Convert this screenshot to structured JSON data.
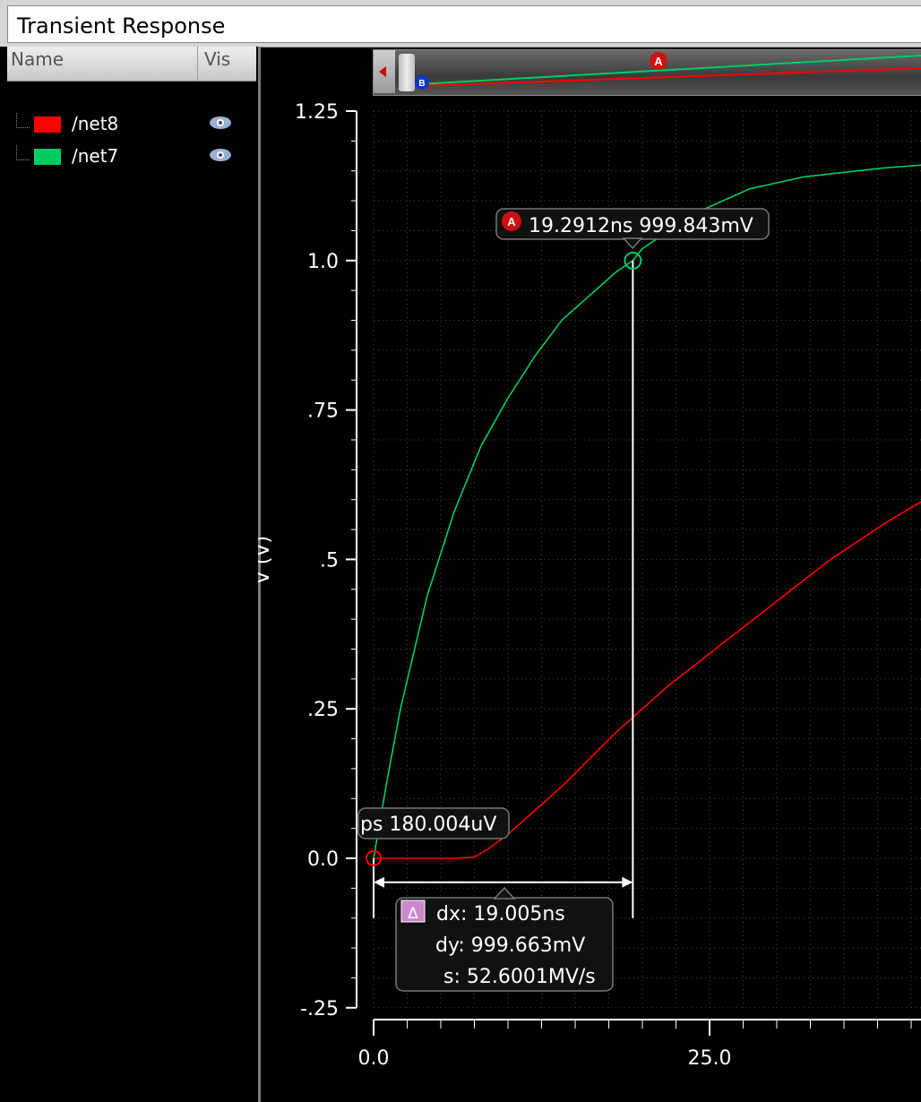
{
  "window": {
    "title": "Transient Response"
  },
  "signal_browser": {
    "col_name": "Name",
    "col_vis": "Vis",
    "signals": [
      {
        "name": "/net8",
        "color": "#ff0000"
      },
      {
        "name": "/net7",
        "color": "#00cc66"
      }
    ]
  },
  "minimap": {
    "marker_a": "A",
    "marker_b": "B"
  },
  "plot": {
    "ylabel": "V (V)",
    "yticks": [
      "1.25",
      "1.0",
      ".75",
      ".5",
      ".25",
      "0.0",
      "-.25"
    ],
    "xticks": [
      "0.0",
      "25.0"
    ],
    "grid": true
  },
  "markers": {
    "a": {
      "badge": "A",
      "label": "19.2912ns 999.843mV"
    },
    "b": {
      "label": "ps 180.004uV"
    },
    "delta": {
      "badge": "Δ",
      "dx": "dx: 19.005ns",
      "dy": "dy: 999.663mV",
      "s": "s: 52.6001MV/s"
    }
  },
  "chart_data": {
    "type": "line",
    "xlabel": "",
    "ylabel": "V (V)",
    "xlim": [
      0,
      41
    ],
    "ylim": [
      -0.25,
      1.25
    ],
    "series": [
      {
        "name": "/net7",
        "color": "#00cc66",
        "x": [
          0,
          1,
          2,
          4,
          6,
          8,
          10,
          12,
          14,
          16,
          18,
          19.29,
          20,
          22,
          24,
          26,
          28,
          30,
          32,
          34,
          36,
          38,
          41
        ],
        "y": [
          0,
          0.13,
          0.25,
          0.44,
          0.58,
          0.69,
          0.77,
          0.84,
          0.9,
          0.94,
          0.98,
          1.0,
          1.02,
          1.05,
          1.08,
          1.1,
          1.12,
          1.13,
          1.14,
          1.145,
          1.15,
          1.155,
          1.16
        ]
      },
      {
        "name": "/net8",
        "color": "#ff0000",
        "x": [
          0,
          2,
          4,
          6,
          7.5,
          8.5,
          10,
          12,
          14,
          16,
          18,
          20,
          22,
          24,
          26,
          28,
          30,
          32,
          34,
          36,
          38,
          41
        ],
        "y": [
          0,
          0,
          0,
          0,
          0.002,
          0.015,
          0.04,
          0.08,
          0.12,
          0.165,
          0.21,
          0.25,
          0.29,
          0.325,
          0.36,
          0.395,
          0.43,
          0.465,
          0.5,
          0.53,
          0.56,
          0.6
        ]
      }
    ]
  }
}
